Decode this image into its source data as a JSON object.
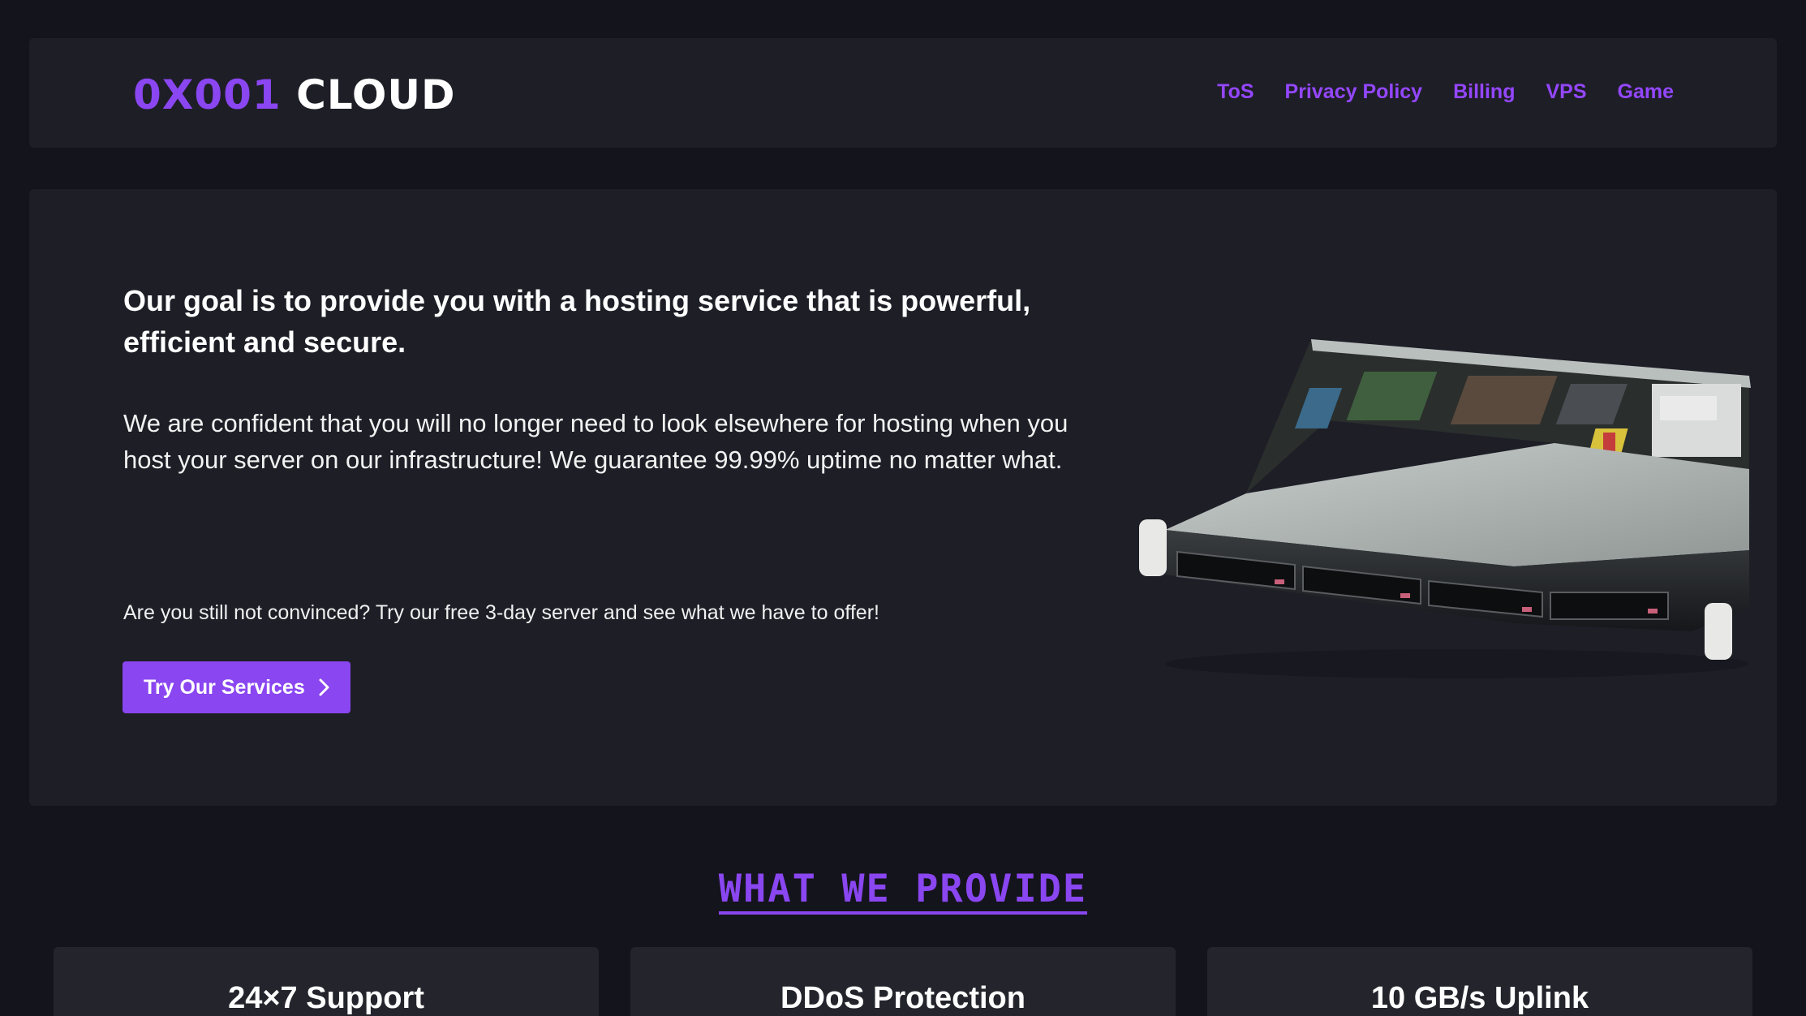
{
  "brand": {
    "part1": "0X001",
    "part2": "CLOUD"
  },
  "nav": {
    "items": [
      "ToS",
      "Privacy Policy",
      "Billing",
      "VPS",
      "Game"
    ]
  },
  "hero": {
    "heading": "Our goal is to provide you with a hosting service that is powerful, efficient and secure.",
    "body": "We are confident that you will no longer need to look elsewhere for hosting when you host your server on our infrastructure! We guarantee 99.99% uptime no matter what.",
    "note": "Are you still not convinced? Try our free 3-day server and see what we have to offer!",
    "cta_label": "Try Our Services",
    "cta_icon": "chevron-right-icon",
    "image": "rack-server-image"
  },
  "section": {
    "title": "WHAT WE PROVIDE"
  },
  "features": [
    {
      "title": "24×7 Support"
    },
    {
      "title": "DDoS Protection"
    },
    {
      "title": "10 GB/s Uplink"
    }
  ],
  "colors": {
    "accent": "#8a46f0",
    "link": "#9447ff",
    "background": "#14141d",
    "panel": "#1e1e27",
    "card": "#24242c"
  }
}
